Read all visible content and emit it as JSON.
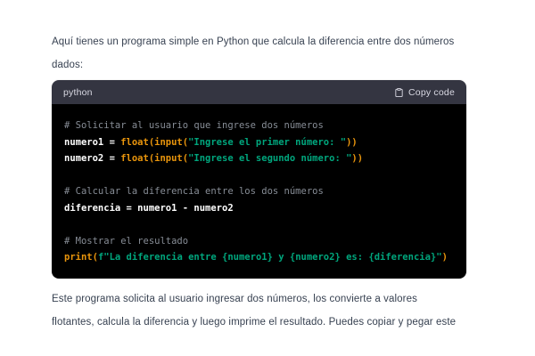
{
  "intro": {
    "lines": [
      "Aquí tienes un programa simple en Python que calcula la diferencia entre dos números",
      "dados:"
    ]
  },
  "code_block": {
    "language": "python",
    "copy_label": "Copy code",
    "icon": "clipboard-icon",
    "colors": {
      "header_bg": "#343541",
      "header_text": "#d9d9e3",
      "code_bg": "#000000",
      "comment": "#878d96",
      "function": "#e9950c",
      "string": "#00a67d",
      "plain": "#ffffff"
    },
    "lines": [
      [
        {
          "c": "comment",
          "t": "# Solicitar al usuario que ingrese dos números"
        }
      ],
      [
        {
          "c": "plain",
          "t": "numero1 = "
        },
        {
          "c": "func",
          "t": "float(input("
        },
        {
          "c": "str",
          "t": "\"Ingrese el primer número: \""
        },
        {
          "c": "func",
          "t": "))"
        }
      ],
      [
        {
          "c": "plain",
          "t": "numero2 = "
        },
        {
          "c": "func",
          "t": "float(input("
        },
        {
          "c": "str",
          "t": "\"Ingrese el segundo número: \""
        },
        {
          "c": "func",
          "t": "))"
        }
      ],
      [],
      [
        {
          "c": "comment",
          "t": "# Calcular la diferencia entre los dos números"
        }
      ],
      [
        {
          "c": "plain",
          "t": "diferencia = numero1 - numero2"
        }
      ],
      [],
      [
        {
          "c": "comment",
          "t": "# Mostrar el resultado"
        }
      ],
      [
        {
          "c": "func",
          "t": "print("
        },
        {
          "c": "str",
          "t": "f\"La diferencia entre {numero1} y {numero2} es: {diferencia}\""
        },
        {
          "c": "func",
          "t": ")"
        }
      ]
    ]
  },
  "outro": {
    "lines": [
      "Este programa solicita al usuario ingresar dos números, los convierte a valores",
      "flotantes, calcula la diferencia y luego imprime el resultado. Puedes copiar y pegar este"
    ]
  }
}
